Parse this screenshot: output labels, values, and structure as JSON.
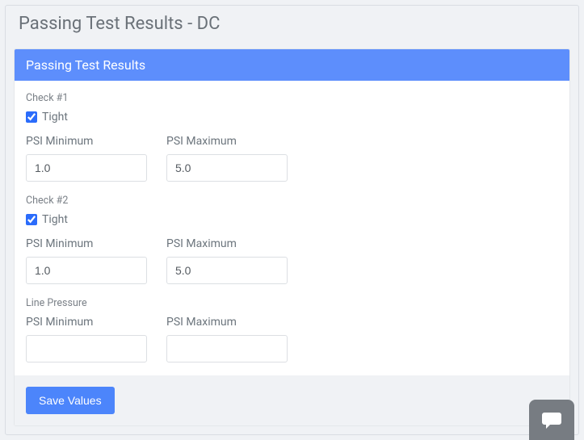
{
  "page": {
    "title": "Passing Test Results - DC"
  },
  "card": {
    "header": "Passing Test Results"
  },
  "labels": {
    "psi_min": "PSI Minimum",
    "psi_max": "PSI Maximum",
    "tight": "Tight"
  },
  "sections": {
    "check1": {
      "title": "Check #1",
      "tight": true,
      "psi_min": "1.0",
      "psi_max": "5.0"
    },
    "check2": {
      "title": "Check #2",
      "tight": true,
      "psi_min": "1.0",
      "psi_max": "5.0"
    },
    "line_pressure": {
      "title": "Line Pressure",
      "psi_min": "",
      "psi_max": ""
    }
  },
  "footer": {
    "save_label": "Save Values"
  }
}
